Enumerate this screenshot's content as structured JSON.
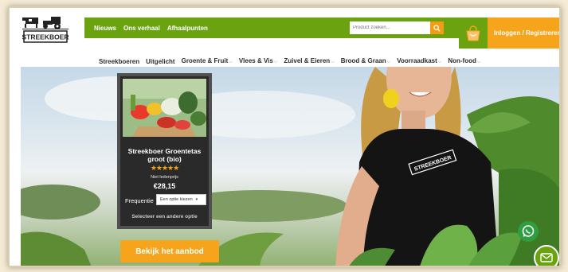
{
  "header": {
    "logo_text": "STREEKBOER",
    "top_nav": [
      {
        "label": "Nieuws"
      },
      {
        "label": "Ons verhaal"
      },
      {
        "label": "Afhaalpunten"
      }
    ],
    "search": {
      "placeholder": "Product zoeken..."
    },
    "login_label": "Inloggen / Registreren",
    "colors": {
      "green": "#6aa30f",
      "orange": "#f5a41b"
    }
  },
  "category_nav": [
    {
      "label": "Streekboeren",
      "has_dropdown": false
    },
    {
      "label": "Uitgelicht",
      "has_dropdown": false
    },
    {
      "label": "Groente & Fruit",
      "has_dropdown": true
    },
    {
      "label": "Vlees & Vis",
      "has_dropdown": true
    },
    {
      "label": "Zuivel & Eieren",
      "has_dropdown": true
    },
    {
      "label": "Brood & Graan",
      "has_dropdown": true
    },
    {
      "label": "Voorraadkast",
      "has_dropdown": true
    },
    {
      "label": "Non-food",
      "has_dropdown": true
    }
  ],
  "hero": {
    "shirt_text": "STREEKBOER",
    "product_card": {
      "title": "Streekboer Groentetas groot (bio)",
      "rating_stars": 5,
      "stars_text": "★★★★★",
      "price_note": "Niet ledenprijs",
      "price": "€28,15",
      "frequency_label": "Frequentie",
      "frequency_select": "Een optie kiezen",
      "other_option_link": "Selecteer een andere optie"
    },
    "cta_label": "Bekijk het aanbod"
  },
  "floating": {
    "whatsapp_icon": "whatsapp-icon",
    "mail_icon": "mail-icon"
  }
}
